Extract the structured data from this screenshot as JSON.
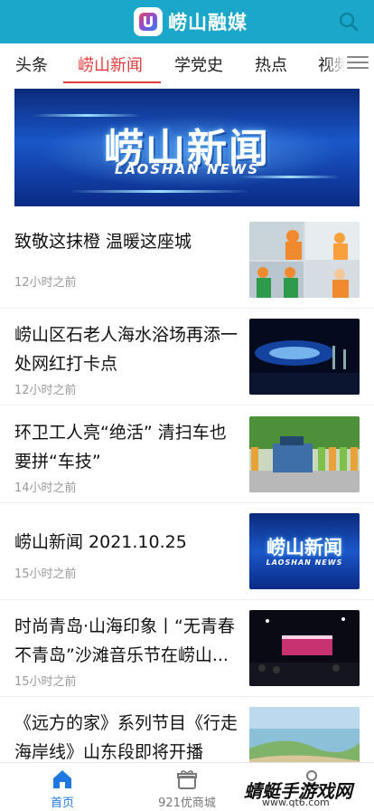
{
  "app": {
    "title": "崂山融媒"
  },
  "tabs": [
    "头条",
    "崂山新闻",
    "学党史",
    "热点",
    "视频"
  ],
  "active_tab": "崂山新闻",
  "banner": {
    "title": "崂山新闻",
    "subtitle": "LAOSHAN NEWS"
  },
  "news": [
    {
      "title": "致敬这抹橙 温暖这座城",
      "time": "12小时之前"
    },
    {
      "title": "崂山区石老人海水浴场再添一处网红打卡点",
      "time": "12小时之前"
    },
    {
      "title": "环卫工人亮“绝活” 清扫车也要拼“车技”",
      "time": "14小时之前"
    },
    {
      "title": "崂山新闻 2021.10.25",
      "time": "15小时之前",
      "thumb_title": "崂山新闻",
      "thumb_sub": "LAOSHAN NEWS"
    },
    {
      "title": "时尚青岛·山海印象丨“无青春不青岛”沙滩音乐节在崂山...",
      "time": "15小时之前"
    },
    {
      "title": "《远方的家》系列节目《行走海岸线》山东段即将开播",
      "time": ""
    }
  ],
  "bottom_nav": [
    {
      "label": "首页",
      "icon": "home-icon"
    },
    {
      "label": "921优商城",
      "icon": "gift-icon"
    },
    {
      "label": "",
      "icon": "user-icon"
    }
  ],
  "watermark": {
    "text": "蜻蜓手游戏网",
    "url": "www.qt6.com"
  },
  "colors": {
    "appbar": "#1aa7c9",
    "active_tab": "#e23c3c",
    "nav_active": "#1f78e0"
  }
}
